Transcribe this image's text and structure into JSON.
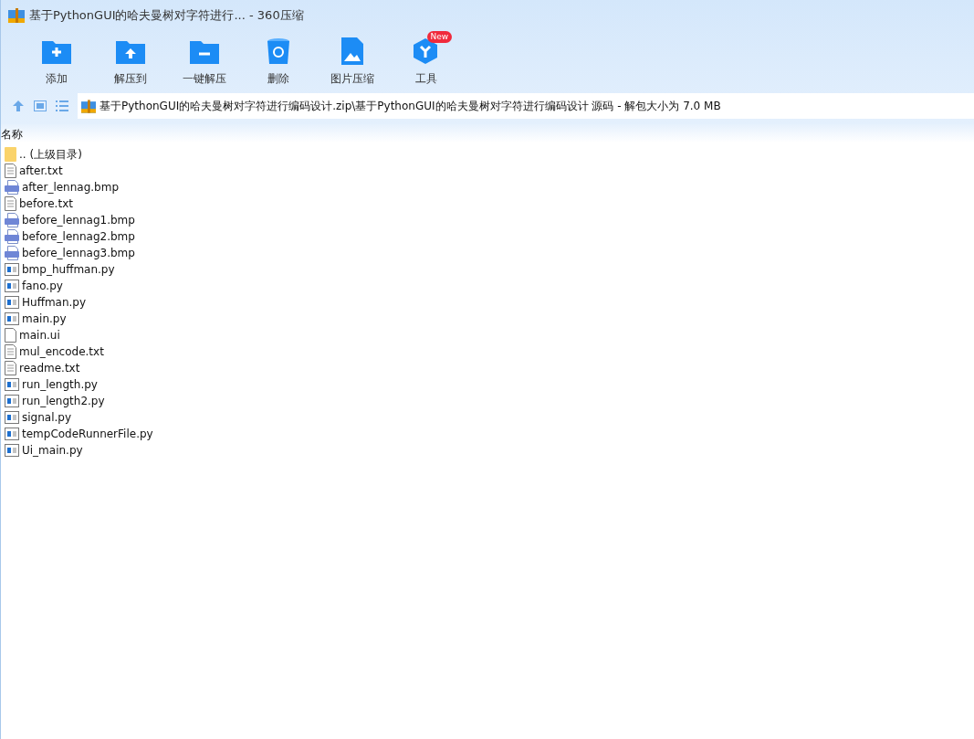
{
  "window": {
    "title": "基于PythonGUI的哈夫曼树对字符进行... - 360压缩"
  },
  "toolbar": [
    {
      "label": "添加",
      "kind": "add"
    },
    {
      "label": "解压到",
      "kind": "extract"
    },
    {
      "label": "一键解压",
      "kind": "oneclick"
    },
    {
      "label": "删除",
      "kind": "delete"
    },
    {
      "label": "图片压缩",
      "kind": "image"
    },
    {
      "label": "工具",
      "kind": "tools",
      "badge": "New"
    }
  ],
  "address_bar": {
    "path": "基于PythonGUI的哈夫曼树对字符进行编码设计.zip\\基于PythonGUI的哈夫曼树对字符进行编码设计 源码 - 解包大小为 7.0 MB"
  },
  "table": {
    "columns": [
      "名称"
    ],
    "rows": [
      {
        "name": ".. (上级目录)",
        "kind": "folder"
      },
      {
        "name": "after.txt",
        "kind": "txt"
      },
      {
        "name": "after_lennag.bmp",
        "kind": "bmp"
      },
      {
        "name": "before.txt",
        "kind": "txt"
      },
      {
        "name": "before_lennag1.bmp",
        "kind": "bmp"
      },
      {
        "name": "before_lennag2.bmp",
        "kind": "bmp"
      },
      {
        "name": "before_lennag3.bmp",
        "kind": "bmp"
      },
      {
        "name": "bmp_huffman.py",
        "kind": "py"
      },
      {
        "name": "fano.py",
        "kind": "py"
      },
      {
        "name": "Huffman.py",
        "kind": "py"
      },
      {
        "name": "main.py",
        "kind": "py"
      },
      {
        "name": "main.ui",
        "kind": "file"
      },
      {
        "name": "mul_encode.txt",
        "kind": "txt"
      },
      {
        "name": "readme.txt",
        "kind": "txt"
      },
      {
        "name": "run_length.py",
        "kind": "py"
      },
      {
        "name": "run_length2.py",
        "kind": "py"
      },
      {
        "name": "signal.py",
        "kind": "py"
      },
      {
        "name": "tempCodeRunnerFile.py",
        "kind": "py"
      },
      {
        "name": "Ui_main.py",
        "kind": "py"
      }
    ]
  }
}
